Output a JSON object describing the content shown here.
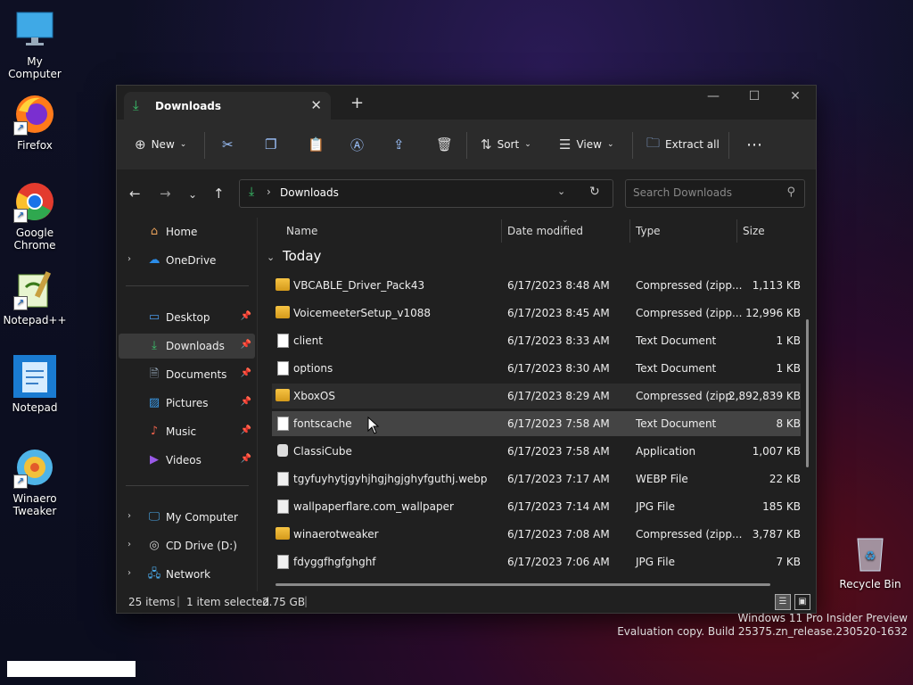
{
  "desktop": {
    "icons": [
      {
        "label": "My Computer"
      },
      {
        "label": "Firefox"
      },
      {
        "label": "Google Chrome"
      },
      {
        "label": "Notepad++"
      },
      {
        "label": "Notepad"
      },
      {
        "label": "Winaero Tweaker"
      }
    ],
    "recycle_bin": "Recycle Bin",
    "watermark_line1": "Windows 11 Pro Insider Preview",
    "watermark_line2": "Evaluation copy. Build 25375.zn_release.230520-1632"
  },
  "window": {
    "tab_title": "Downloads",
    "toolbar": {
      "new_label": "New",
      "sort_label": "Sort",
      "view_label": "View",
      "extract_label": "Extract all"
    },
    "address": {
      "location": "Downloads"
    },
    "search": {
      "placeholder": "Search Downloads"
    },
    "sidebar": {
      "home": "Home",
      "onedrive": "OneDrive",
      "desktop": "Desktop",
      "downloads": "Downloads",
      "documents": "Documents",
      "pictures": "Pictures",
      "music": "Music",
      "videos": "Videos",
      "mycomputer": "My Computer",
      "cddrive": "CD Drive (D:)",
      "network": "Network"
    },
    "columns": {
      "name": "Name",
      "date": "Date modified",
      "type": "Type",
      "size": "Size"
    },
    "group_label": "Today",
    "files": [
      {
        "name": "VBCABLE_Driver_Pack43",
        "date": "6/17/2023 8:48 AM",
        "type": "Compressed (zipp...",
        "size": "1,113 KB",
        "icon": "zip"
      },
      {
        "name": "VoicemeeterSetup_v1088",
        "date": "6/17/2023 8:45 AM",
        "type": "Compressed (zipp...",
        "size": "12,996 KB",
        "icon": "zip"
      },
      {
        "name": "client",
        "date": "6/17/2023 8:33 AM",
        "type": "Text Document",
        "size": "1 KB",
        "icon": "doc"
      },
      {
        "name": "options",
        "date": "6/17/2023 8:30 AM",
        "type": "Text Document",
        "size": "1 KB",
        "icon": "doc"
      },
      {
        "name": "XboxOS",
        "date": "6/17/2023 8:29 AM",
        "type": "Compressed (zipp...",
        "size": "2,892,839 KB",
        "icon": "zip"
      },
      {
        "name": "fontscache",
        "date": "6/17/2023 7:58 AM",
        "type": "Text Document",
        "size": "8 KB",
        "icon": "doc"
      },
      {
        "name": "ClassiCube",
        "date": "6/17/2023 7:58 AM",
        "type": "Application",
        "size": "1,007 KB",
        "icon": "app"
      },
      {
        "name": "tgyfuyhytjgyhjhgjhgjghyfguthj.webp",
        "date": "6/17/2023 7:17 AM",
        "type": "WEBP File",
        "size": "22 KB",
        "icon": "jpg"
      },
      {
        "name": "wallpaperflare.com_wallpaper",
        "date": "6/17/2023 7:14 AM",
        "type": "JPG File",
        "size": "185 KB",
        "icon": "jpg"
      },
      {
        "name": "winaerotweaker",
        "date": "6/17/2023 7:08 AM",
        "type": "Compressed (zipp...",
        "size": "3,787 KB",
        "icon": "zip"
      },
      {
        "name": "fdyggfhgfghghf",
        "date": "6/17/2023 7:06 AM",
        "type": "JPG File",
        "size": "7 KB",
        "icon": "jpg"
      }
    ],
    "status": {
      "items": "25 items",
      "selected": "1 item selected",
      "size": "2.75 GB"
    }
  }
}
